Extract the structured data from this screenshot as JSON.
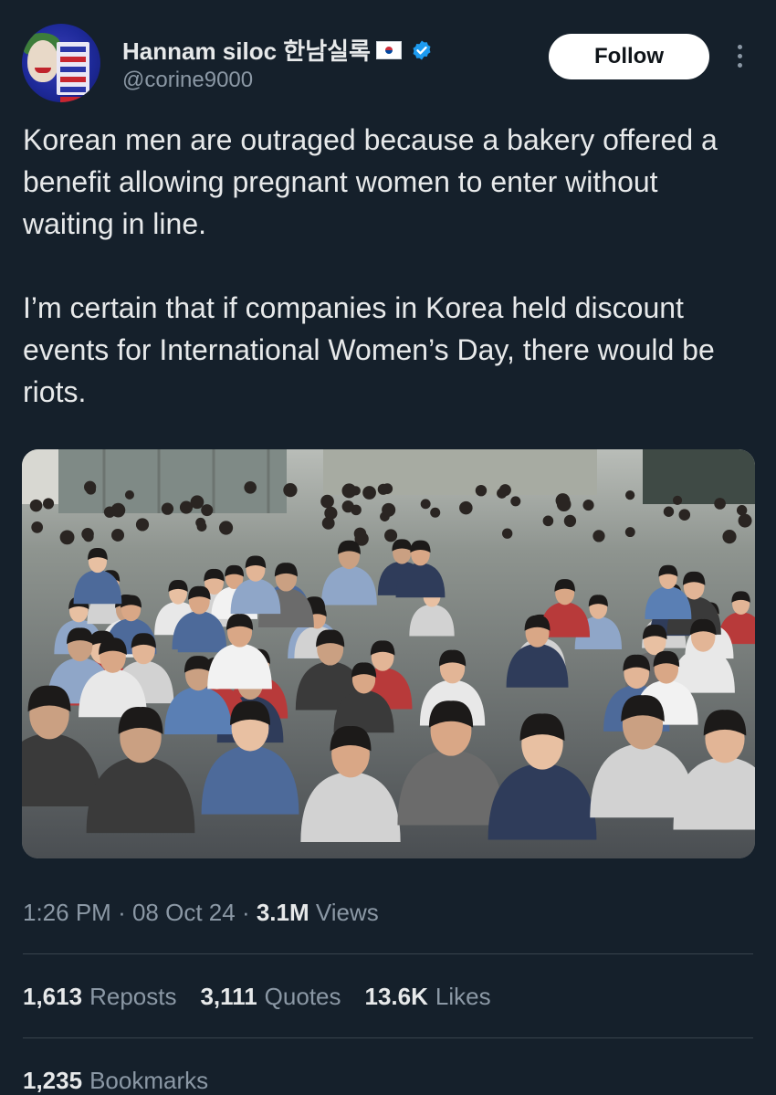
{
  "author": {
    "display_name": "Hannam siloc 한남실록",
    "handle": "@corine9000",
    "flag_icon": "south-korea-flag-icon",
    "verified_icon": "verified-badge-icon",
    "verified_color": "#1d9bf0"
  },
  "actions": {
    "follow_label": "Follow",
    "more_icon": "more-vertical-icon"
  },
  "tweet": {
    "paragraph_1": "Korean men are outraged because a bakery offered a benefit allowing pregnant women to enter without waiting in line.",
    "paragraph_2": "I’m certain that if companies in Korea held discount events for International Women’s Day, there would be riots."
  },
  "media": {
    "type": "photo",
    "subject": "crowd-photo"
  },
  "meta": {
    "time": "1:26 PM",
    "separator": "·",
    "date": "08 Oct 24",
    "views_count": "3.1M",
    "views_label": "Views"
  },
  "stats": {
    "reposts_count": "1,613",
    "reposts_label": "Reposts",
    "quotes_count": "3,111",
    "quotes_label": "Quotes",
    "likes_count": "13.6K",
    "likes_label": "Likes",
    "bookmarks_count": "1,235",
    "bookmarks_label": "Bookmarks"
  },
  "colors": {
    "background": "#15202b",
    "text_primary": "#e7e9ea",
    "text_secondary": "#8b98a5",
    "divider": "#38444d",
    "follow_bg": "#ffffff"
  }
}
